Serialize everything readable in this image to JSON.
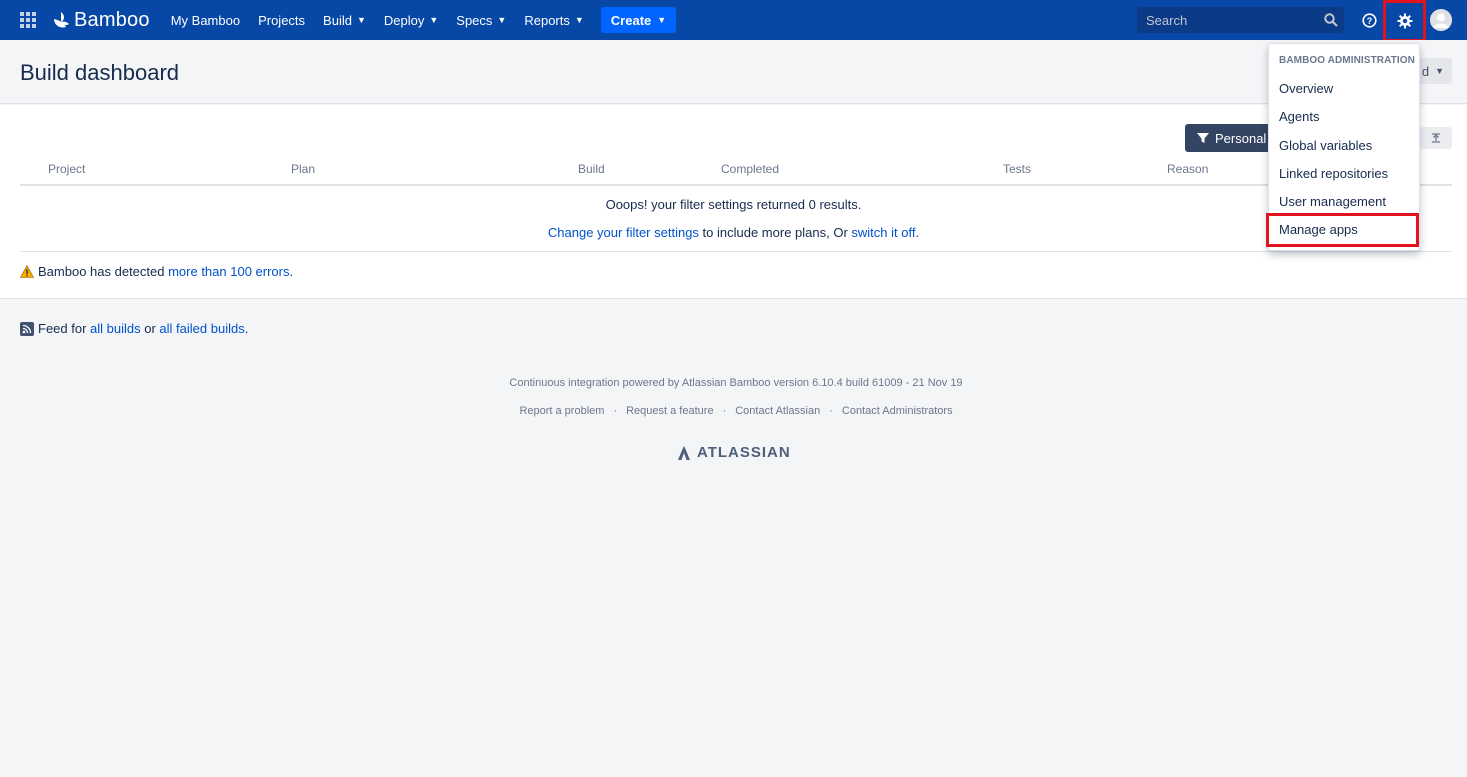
{
  "nav": {
    "logo_text": "Bamboo",
    "items": [
      {
        "label": "My Bamboo",
        "dropdown": false
      },
      {
        "label": "Projects",
        "dropdown": false
      },
      {
        "label": "Build",
        "dropdown": true
      },
      {
        "label": "Deploy",
        "dropdown": true
      },
      {
        "label": "Specs",
        "dropdown": true
      },
      {
        "label": "Reports",
        "dropdown": true
      }
    ],
    "create_label": "Create",
    "search_placeholder": "Search"
  },
  "header": {
    "title": "Build dashboard",
    "dropdown_partial": "d"
  },
  "toolbar": {
    "filter_label": "Personal f"
  },
  "table": {
    "columns": [
      "Project",
      "Plan",
      "Build",
      "Completed",
      "Tests",
      "Reason"
    ],
    "empty_message": "Ooops! your filter settings returned 0 results.",
    "change_filter_link": "Change your filter settings",
    "change_filter_middle": " to include more plans, Or ",
    "switch_off_link": "switch it off",
    "switch_off_suffix": "."
  },
  "errors": {
    "prefix": "Bamboo has detected ",
    "link": "more than 100 errors",
    "suffix": "."
  },
  "feed": {
    "prefix": "Feed for ",
    "all_builds": "all builds",
    "middle": " or ",
    "failed_builds": "all failed builds",
    "suffix": "."
  },
  "footer": {
    "powered_by": "Continuous integration powered by Atlassian Bamboo version 6.10.4 build 61009 - 21 Nov 19",
    "links": [
      "Report a problem",
      "Request a feature",
      "Contact Atlassian",
      "Contact Administrators"
    ],
    "separator": "·",
    "atlassian": "ATLASSIAN"
  },
  "admin_menu": {
    "heading": "BAMBOO ADMINISTRATION",
    "items": [
      "Overview",
      "Agents",
      "Global variables",
      "Linked repositories",
      "User management",
      "Manage apps"
    ]
  },
  "colors": {
    "nav_bg": "#0747a6",
    "create_bg": "#0065ff",
    "highlight": "#e0141e",
    "link": "#0052cc"
  }
}
